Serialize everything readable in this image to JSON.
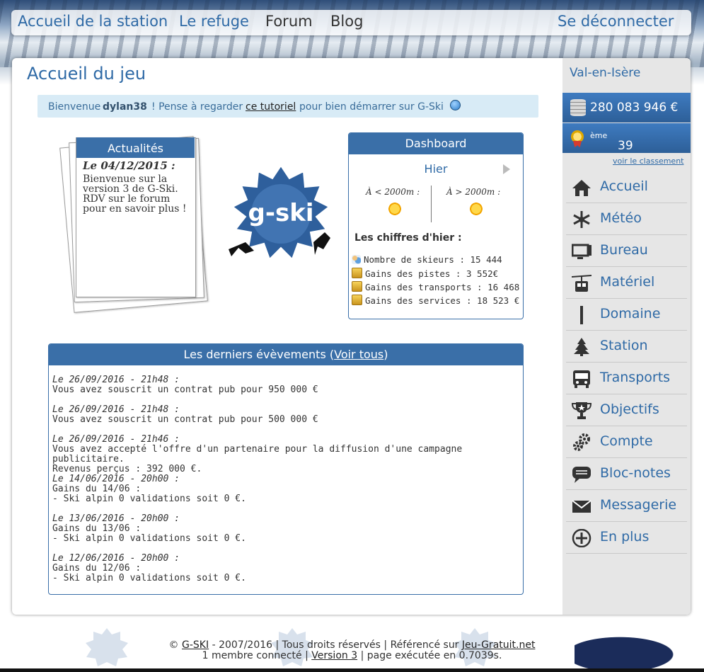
{
  "topnav": {
    "accueil_station": "Accueil de la station",
    "refuge": "Le refuge",
    "forum": "Forum",
    "blog": "Blog",
    "logout": "Se déconnecter"
  },
  "page": {
    "title": "Accueil du jeu"
  },
  "welcome": {
    "prefix": "Bienvenue",
    "username": "dylan38",
    "middle": "! Pense à regarder",
    "link": "ce tutoriel",
    "suffix": "pour bien démarrer sur G-Ski"
  },
  "news": {
    "title": "Actualités",
    "date": "Le 04/12/2015 :",
    "text": "Bienvenue sur la version 3 de G-Ski. RDV sur le forum pour en savoir plus !"
  },
  "logo": {
    "text": "g-ski"
  },
  "dashboard": {
    "title": "Dashboard",
    "day": "Hier",
    "alt_low": "À < 2000m :",
    "alt_high": "À > 2000m :",
    "weather_low": "sun-icon",
    "weather_high": "sun-icon",
    "stats_title": "Les chiffres d'hier :",
    "stats": [
      "Nombre de skieurs : 15 444",
      "Gains des pistes : 3 552€",
      "Gains des transports : 16 468 €",
      "Gains des services : 18 523 €"
    ]
  },
  "events": {
    "title_prefix": "Les derniers évèvements (",
    "title_link": "Voir tous",
    "title_suffix": ")",
    "items": [
      {
        "date": "Le 26/09/2016 - 21h48 :",
        "lines": [
          "Vous avez souscrit un contrat pub pour 950 000 €"
        ]
      },
      {
        "date": "Le 26/09/2016 - 21h48 :",
        "lines": [
          "Vous avez souscrit un contrat pub pour 500 000 €"
        ]
      },
      {
        "date": "Le 26/09/2016 - 21h46 :",
        "lines": [
          "Vous avez accepté l'offre d'un partenaire pour la diffusion d'une campagne publicitaire.",
          "Revenus perçus : 392 000 €."
        ]
      },
      {
        "date": "Le 14/06/2016 - 20h00 :",
        "lines": [
          "Gains du 14/06 :",
          "- Ski alpin 0 validations soit 0 €."
        ]
      },
      {
        "date": "Le 13/06/2016 - 20h00 :",
        "lines": [
          "Gains du 13/06 :",
          "- Ski alpin 0 validations soit 0 €."
        ]
      },
      {
        "date": "Le 12/06/2016 - 20h00 :",
        "lines": [
          "Gains du 12/06 :",
          "- Ski alpin 0 validations soit 0 €."
        ]
      }
    ]
  },
  "sidebar": {
    "city": "Val-en-Isère",
    "money": "280 083 946 €",
    "rank_num": "39",
    "rank_suffix": "ème",
    "classement_link": "voir le classement",
    "menu": [
      {
        "label": "Accueil",
        "icon": "home-icon"
      },
      {
        "label": "Météo",
        "icon": "snowflake-icon"
      },
      {
        "label": "Bureau",
        "icon": "monitor-icon"
      },
      {
        "label": "Matériel",
        "icon": "gondola-icon"
      },
      {
        "label": "Domaine",
        "icon": "piste-pole-icon"
      },
      {
        "label": "Station",
        "icon": "tree-icon"
      },
      {
        "label": "Transports",
        "icon": "bus-icon"
      },
      {
        "label": "Objectifs",
        "icon": "trophy-icon"
      },
      {
        "label": "Compte",
        "icon": "gears-icon"
      },
      {
        "label": "Bloc-notes",
        "icon": "speech-bubble-icon"
      },
      {
        "label": "Messagerie",
        "icon": "envelope-icon"
      },
      {
        "label": "En plus",
        "icon": "plus-circle-icon"
      }
    ]
  },
  "footer": {
    "copyright": "©",
    "brand_link": "G-SKI",
    "line1_mid": "- 2007/2016 | Tous droits réservés | Référencé sur",
    "ref_link": "Jeu-Gratuit.net",
    "line2_prefix": "1 membre connecté |",
    "version_link": "Version 3",
    "line2_suffix": "| page exécutée en 0.7039s."
  },
  "colors": {
    "accent": "#2f6aa6",
    "header_blue": "#3a6fa8",
    "welcome_bg": "#d8ebf6",
    "sidebar_bg": "#e6e6e6"
  }
}
